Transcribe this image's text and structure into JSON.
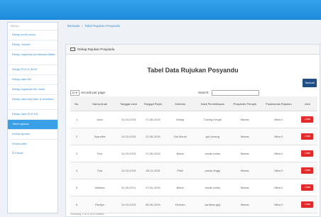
{
  "sidebar": {
    "header": "MENU",
    "items": [
      {
        "label": "Rekap profil posko"
      },
      {
        "label": "Rekap Jumlah"
      },
      {
        "label": "Rekap registrasi pembinaan balita"
      },
      {
        "label": "Rekap PUS & WUS"
      },
      {
        "label": "Rekap data KB"
      },
      {
        "label": "Rekap registrasi ibu hamil"
      },
      {
        "label": "Rekap data bayi lahir & kematian"
      },
      {
        "label": "Rekap data PUS KB"
      },
      {
        "label": "Tabel rujukan"
      },
      {
        "label": "Kelola laporan"
      },
      {
        "label": "Kelola data"
      },
      {
        "label": "Keluar"
      }
    ]
  },
  "breadcrumb": {
    "home": "Beranda",
    "current": "Tabel Rujukan Posyandu"
  },
  "panel": {
    "header": "Rekap Rujukan Posyandu"
  },
  "page_title": "Tabel Data Rujukan Posyandu",
  "add_button": "Tambah",
  "length_control": {
    "value": "10",
    "label": "records per page"
  },
  "search": {
    "label": "Search:",
    "value": ""
  },
  "table": {
    "headers": [
      "No.",
      "Nama Anak",
      "Tanggal Lahir",
      "Tanggal Rujuk",
      "Keluhan",
      "Hasil Pemeriksaan",
      "Posyandu Perujuk",
      "Puskesmas Rujukan",
      "Aksi"
    ],
    "rows": [
      {
        "no": "1",
        "nama": "Ardo",
        "lahir": "10-03-2015",
        "rujuk": "07-08-2016",
        "keluhan": "Mangi",
        "hasil": "Cacing Kregal",
        "perujuk": "Mawar",
        "rujukan": "Mitra II",
        "aksi": "Lihat"
      },
      {
        "no": "2",
        "nama": "Syarohta",
        "lahir": "10-03-2015",
        "rujuk": "12-08-2016",
        "keluhan": "Gizi Buruk",
        "hasil": "gizi kurang",
        "perujuk": "Mawar",
        "rujukan": "Mitra II",
        "aksi": "Lihat"
      },
      {
        "no": "3",
        "nama": "Fina",
        "lahir": "10-03-2015",
        "rujuk": "07-08-2016",
        "keluhan": "Batuk",
        "hasil": "sesak nafas",
        "perujuk": "Mawar",
        "rujukan": "Mitra II",
        "aksi": "Lihat"
      },
      {
        "no": "4",
        "nama": "Tina",
        "lahir": "10-03-2015",
        "rujuk": "08-11-2016",
        "keluhan": "Pilek",
        "hasil": "panas tinggi",
        "perujuk": "Mawar",
        "rujukan": "Mitra II",
        "aksi": "Lihat"
      },
      {
        "no": "5",
        "nama": "Maliana",
        "lahir": "01-09-2014",
        "rujuk": "07-04-2016",
        "keluhan": "Batuk",
        "hasil": "sesak nafas",
        "perujuk": "Mawar",
        "rujukan": "Mitra II",
        "aksi": "Lihat"
      },
      {
        "no": "6",
        "nama": "Radiya",
        "lahir": "10-03-2015",
        "rujuk": "06-06-2016",
        "keluhan": "Demam",
        "hasil": "cantikan gigi",
        "perujuk": "Mawar",
        "rujukan": "Mitra II",
        "aksi": "Lihat"
      }
    ]
  },
  "info": "Showing 1 to 6 of 6 entries",
  "colors": {
    "topbar": "#1d8ad9",
    "active_menu": "#3aa0e6",
    "add_button": "#1e4e86",
    "view_button": "#e32a2a"
  }
}
